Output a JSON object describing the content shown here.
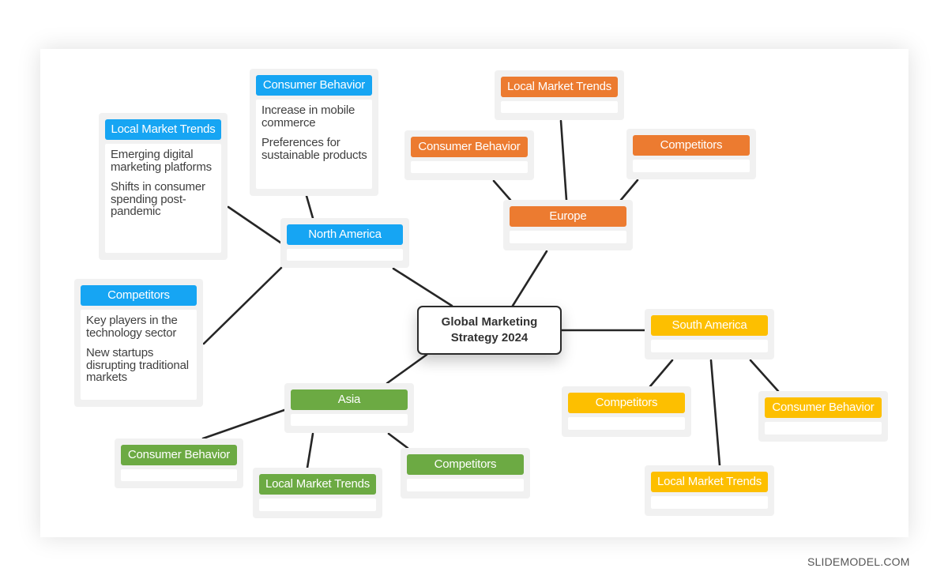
{
  "center": {
    "title": "Global Marketing Strategy 2024"
  },
  "colors": {
    "north_america": "#16a5f3",
    "europe": "#ec7b30",
    "south_america": "#fdbf00",
    "asia": "#6caa43",
    "line": "#262626"
  },
  "regions": {
    "north_america": {
      "label": "North America",
      "local_market_trends": {
        "label": "Local Market Trends",
        "items": [
          "Emerging digital marketing platforms",
          "Shifts in consumer spending post-pandemic"
        ]
      },
      "consumer_behavior": {
        "label": "Consumer Behavior",
        "items": [
          "Increase in mobile commerce",
          "Preferences for sustainable products"
        ]
      },
      "competitors": {
        "label": "Competitors",
        "items": [
          "Key players in the technology sector",
          "New startups disrupting traditional markets"
        ]
      }
    },
    "europe": {
      "label": "Europe",
      "local_market_trends": {
        "label": "Local Market Trends"
      },
      "consumer_behavior": {
        "label": "Consumer Behavior"
      },
      "competitors": {
        "label": "Competitors"
      }
    },
    "south_america": {
      "label": "South America",
      "competitors": {
        "label": "Competitors"
      },
      "local_market_trends": {
        "label": "Local Market Trends"
      },
      "consumer_behavior": {
        "label": "Consumer Behavior"
      }
    },
    "asia": {
      "label": "Asia",
      "consumer_behavior": {
        "label": "Consumer Behavior"
      },
      "local_market_trends": {
        "label": "Local Market Trends"
      },
      "competitors": {
        "label": "Competitors"
      }
    }
  },
  "footer": {
    "brand": "SLIDEMODEL.COM"
  }
}
